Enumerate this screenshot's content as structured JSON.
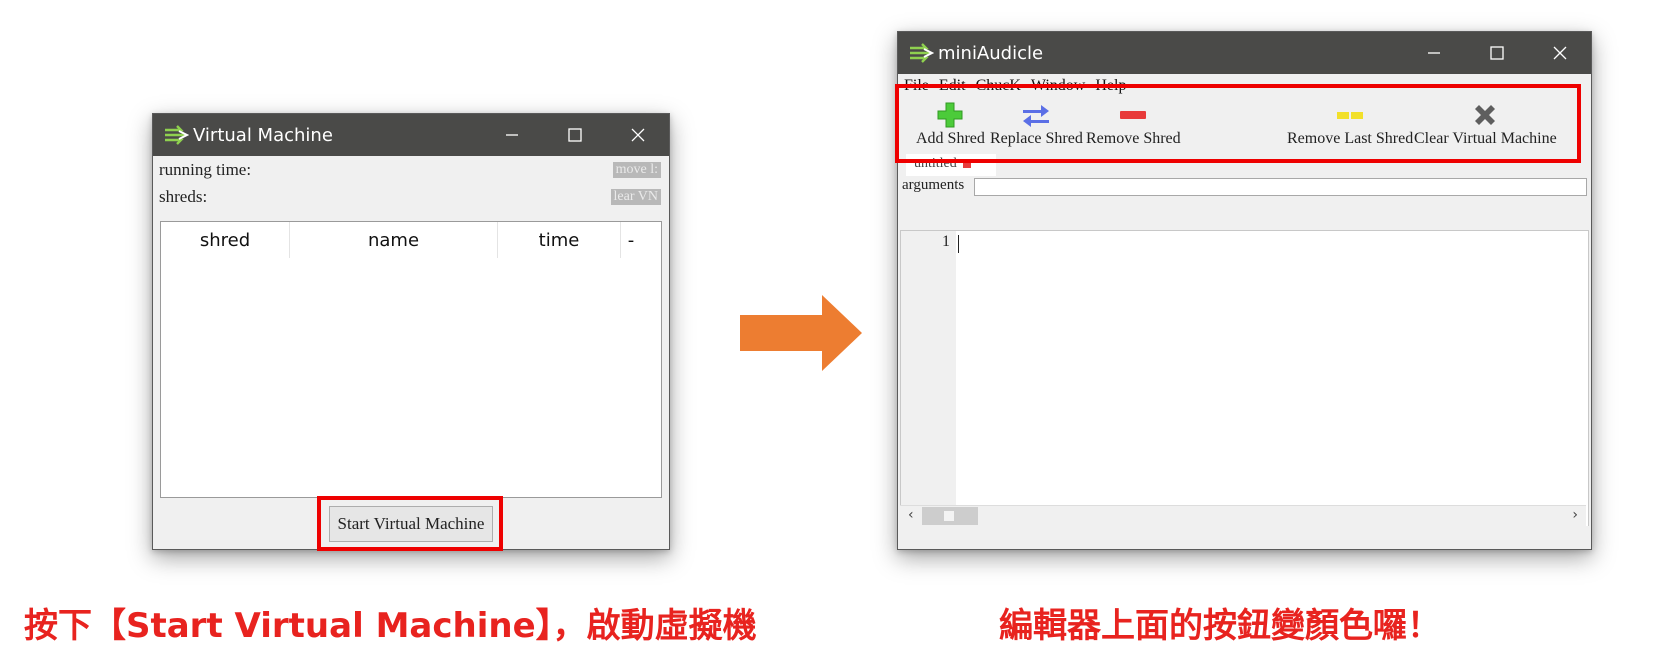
{
  "vm_window": {
    "title": "Virtual Machine",
    "running_time_label": "running time:",
    "shreds_label": "shreds:",
    "ghost_button_1": "move l:",
    "ghost_button_2": "lear VN",
    "columns": [
      "shred",
      "name",
      "time",
      "-"
    ],
    "start_button": "Start Virtual Machine"
  },
  "editor_window": {
    "title": "miniAudicle",
    "menu": [
      "File",
      "Edit",
      "ChucK",
      "Window",
      "Help"
    ],
    "toolbar": {
      "add": "Add Shred",
      "replace": "Replace Shred",
      "remove": "Remove Shred",
      "remove_last": "Remove Last Shred",
      "clear_vm": "Clear Virtual Machine"
    },
    "tab_label": "untitled",
    "arguments_label": "arguments",
    "line_number": "1"
  },
  "captions": {
    "left": "按下【Start Virtual Machine】，啟動虛擬機",
    "right": "編輯器上面的按鈕變顏色囉！"
  },
  "colors": {
    "highlight_red": "#ee0000",
    "caption_red": "#e8231f",
    "arrow_orange": "#ed7d31",
    "titlebar": "#4a4a48"
  }
}
